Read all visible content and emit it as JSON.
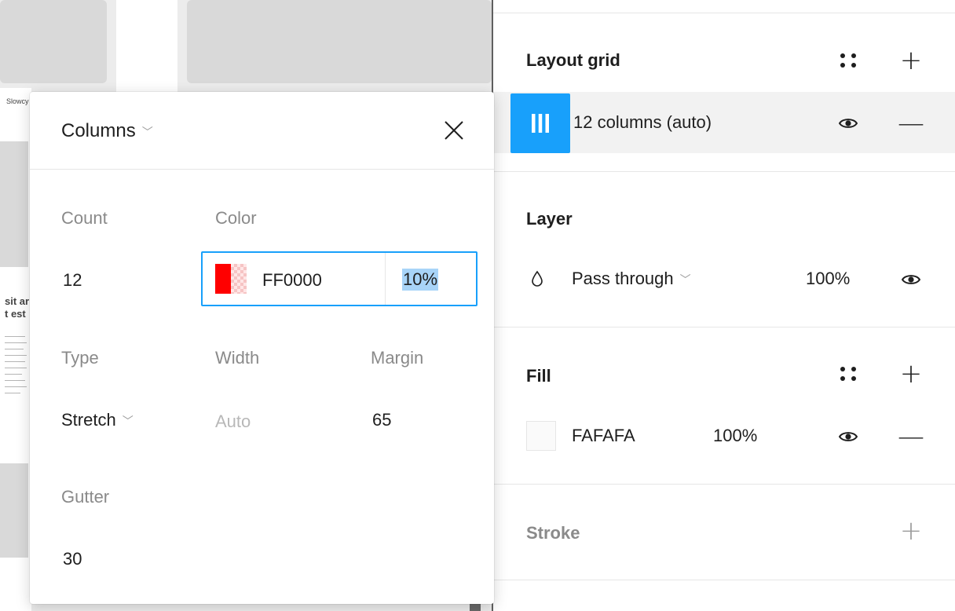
{
  "canvas": {
    "snippet_top": "Slowcy",
    "snippet_mid_1": "sit ar",
    "snippet_mid_2": "t est"
  },
  "popover": {
    "type_label": "Columns",
    "count": {
      "label": "Count",
      "value": "12"
    },
    "color": {
      "label": "Color",
      "hex": "FF0000",
      "opacity": "10%",
      "swatch": "#FF0000"
    },
    "type": {
      "label": "Type",
      "value": "Stretch"
    },
    "width": {
      "label": "Width",
      "placeholder": "Auto"
    },
    "margin": {
      "label": "Margin",
      "value": "65"
    },
    "gutter": {
      "label": "Gutter",
      "value": "30"
    }
  },
  "panel": {
    "layout_grid": {
      "title": "Layout grid",
      "grid_item_label": "12 columns (auto)",
      "accent": "#18A0FB"
    },
    "layer": {
      "title": "Layer",
      "blend_mode": "Pass through",
      "opacity": "100%"
    },
    "fill": {
      "title": "Fill",
      "hex": "FAFAFA",
      "opacity": "100%",
      "swatch": "#FAFAFA"
    },
    "stroke": {
      "title": "Stroke"
    }
  }
}
